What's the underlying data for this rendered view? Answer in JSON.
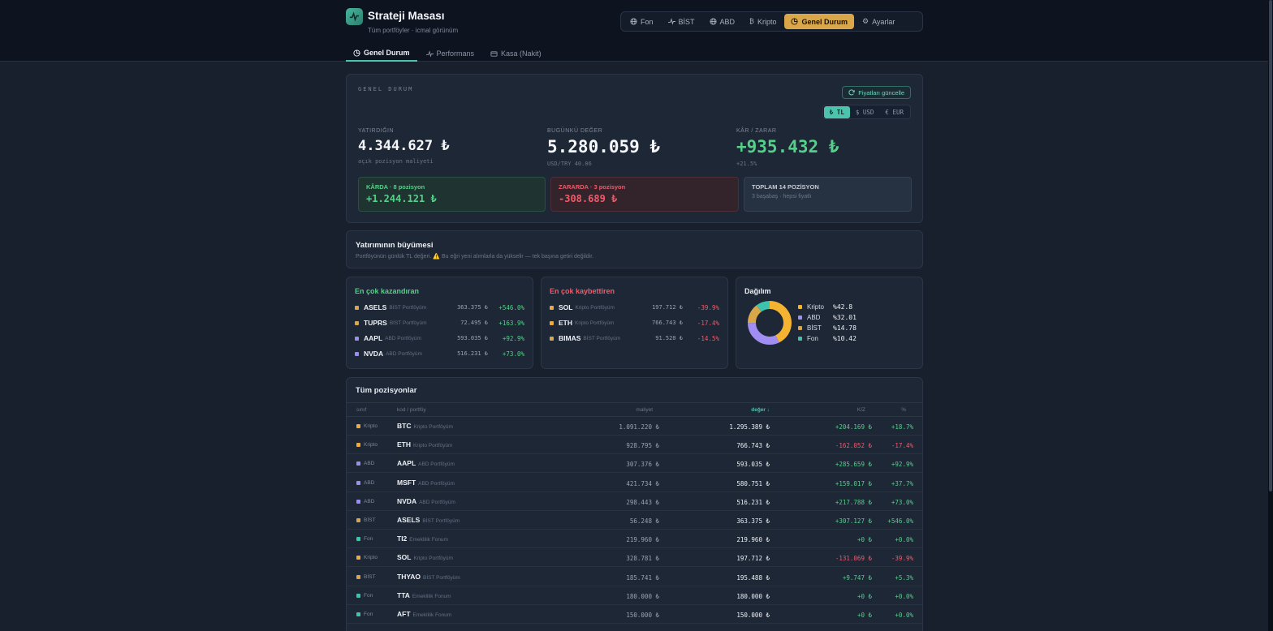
{
  "app": {
    "title": "Strateji Masası",
    "subtitle": "Tüm portföyler · icmal görünüm"
  },
  "nav": [
    {
      "label": "Fon",
      "icon": "globe-icon"
    },
    {
      "label": "BİST",
      "icon": "pulse-icon"
    },
    {
      "label": "ABD",
      "icon": "globe-icon"
    },
    {
      "label": "Kripto",
      "icon": "bitcoin-icon"
    },
    {
      "label": "Genel Durum",
      "icon": "pie-icon",
      "active": true
    },
    {
      "label": "Ayarlar",
      "icon": "gear-icon"
    }
  ],
  "tabs": [
    {
      "label": "Genel Durum",
      "active": true
    },
    {
      "label": "Performans"
    },
    {
      "label": "Kasa (Nakit)"
    }
  ],
  "summary": {
    "kicker": "GENEL DURUM",
    "refresh_label": "Fiyatları güncelle",
    "currencies": [
      "₺ TL",
      "$ USD",
      "€ EUR"
    ],
    "invested": {
      "label": "YATIRDIĞIN",
      "value": "4.344.627 ₺",
      "sub": "açık pozisyon maliyeti"
    },
    "today": {
      "label": "BUGÜNKÜ DEĞER",
      "value": "5.280.059 ₺",
      "sub": "USD/TRY 40.06"
    },
    "pl": {
      "label": "KÂR / ZARAR",
      "value": "+935.432 ₺",
      "sub": "+21.5%"
    },
    "gain": {
      "label": "KÂRDA · 8 pozisyon",
      "value": "+1.244.121 ₺"
    },
    "loss": {
      "label": "ZARARDA · 3 pozisyon",
      "value": "-308.689 ₺"
    },
    "total": {
      "label": "TOPLAM 14 POZİSYON",
      "sub": "3 başabaş · hepsi fiyatlı"
    }
  },
  "growth": {
    "title": "Yatırımının büyümesi",
    "sub": "Portföyünün günlük TL değeri. ⚠️ Bu eğri yeni alımlarla da yükselir — tek başına getiri değildir."
  },
  "gainers": {
    "title": "En çok kazandıran",
    "rows": [
      {
        "code": "ASELS",
        "port": "BİST Portföyüm",
        "amt": "363.375 ₺",
        "pct": "+546.0%",
        "color": "#d9a64a"
      },
      {
        "code": "TUPRS",
        "port": "BİST Portföyüm",
        "amt": "72.495 ₺",
        "pct": "+163.9%",
        "color": "#d9a64a"
      },
      {
        "code": "AAPL",
        "port": "ABD Portföyüm",
        "amt": "593.035 ₺",
        "pct": "+92.9%",
        "color": "#9b8cf0"
      },
      {
        "code": "NVDA",
        "port": "ABD Portföyüm",
        "amt": "516.231 ₺",
        "pct": "+73.0%",
        "color": "#9b8cf0"
      }
    ]
  },
  "losers": {
    "title": "En çok kaybettiren",
    "rows": [
      {
        "code": "SOL",
        "port": "Kripto Portföyüm",
        "amt": "197.712 ₺",
        "pct": "-39.9%",
        "color": "#f0a93a"
      },
      {
        "code": "ETH",
        "port": "Kripto Portföyüm",
        "amt": "766.743 ₺",
        "pct": "-17.4%",
        "color": "#f0a93a"
      },
      {
        "code": "BIMAS",
        "port": "BİST Portföyüm",
        "amt": "91.520 ₺",
        "pct": "-14.5%",
        "color": "#d9a64a"
      }
    ]
  },
  "distribution": {
    "title": "Dağılım",
    "items": [
      {
        "name": "Kripto",
        "label": "%42.8",
        "value": 42.8,
        "color": "#f4b431"
      },
      {
        "name": "ABD",
        "label": "%32.01",
        "value": 32.01,
        "color": "#a08ef2"
      },
      {
        "name": "BİST",
        "label": "%14.78",
        "value": 14.78,
        "color": "#d9a64a"
      },
      {
        "name": "Fon",
        "label": "%10.42",
        "value": 10.42,
        "color": "#3cc4ad"
      }
    ]
  },
  "positions": {
    "title": "Tüm pozisyonlar",
    "headers": {
      "class": "sınıf",
      "code": "kod / portföy",
      "cost": "maliyet",
      "value": "değer ↓",
      "pl": "K/Z",
      "pct": "%"
    },
    "rows": [
      {
        "cls": "Kripto",
        "code": "BTC",
        "port": "Kripto Portföyüm",
        "cost": "1.091.220 ₺",
        "value": "1.295.389 ₺",
        "pl": "+204.169 ₺",
        "pct": "+18.7%",
        "color": "#f0a93a",
        "pos": true
      },
      {
        "cls": "Kripto",
        "code": "ETH",
        "port": "Kripto Portföyüm",
        "cost": "928.795 ₺",
        "value": "766.743 ₺",
        "pl": "-162.052 ₺",
        "pct": "-17.4%",
        "color": "#f0a93a",
        "pos": false
      },
      {
        "cls": "ABD",
        "code": "AAPL",
        "port": "ABD Portföyüm",
        "cost": "307.376 ₺",
        "value": "593.035 ₺",
        "pl": "+285.659 ₺",
        "pct": "+92.9%",
        "color": "#9b8cf0",
        "pos": true
      },
      {
        "cls": "ABD",
        "code": "MSFT",
        "port": "ABD Portföyüm",
        "cost": "421.734 ₺",
        "value": "580.751 ₺",
        "pl": "+159.017 ₺",
        "pct": "+37.7%",
        "color": "#9b8cf0",
        "pos": true
      },
      {
        "cls": "ABD",
        "code": "NVDA",
        "port": "ABD Portföyüm",
        "cost": "298.443 ₺",
        "value": "516.231 ₺",
        "pl": "+217.788 ₺",
        "pct": "+73.0%",
        "color": "#9b8cf0",
        "pos": true
      },
      {
        "cls": "BİST",
        "code": "ASELS",
        "port": "BİST Portföyüm",
        "cost": "56.248 ₺",
        "value": "363.375 ₺",
        "pl": "+307.127 ₺",
        "pct": "+546.0%",
        "color": "#d9a64a",
        "pos": true
      },
      {
        "cls": "Fon",
        "code": "TI2",
        "port": "Emeklilik Fonum",
        "cost": "219.960 ₺",
        "value": "219.960 ₺",
        "pl": "+0 ₺",
        "pct": "+0.0%",
        "color": "#3cc4ad",
        "pos": true
      },
      {
        "cls": "Kripto",
        "code": "SOL",
        "port": "Kripto Portföyüm",
        "cost": "328.781 ₺",
        "value": "197.712 ₺",
        "pl": "-131.069 ₺",
        "pct": "-39.9%",
        "color": "#f0a93a",
        "pos": false
      },
      {
        "cls": "BİST",
        "code": "THYAO",
        "port": "BİST Portföyüm",
        "cost": "185.741 ₺",
        "value": "195.488 ₺",
        "pl": "+9.747 ₺",
        "pct": "+5.3%",
        "color": "#d9a64a",
        "pos": true
      },
      {
        "cls": "Fon",
        "code": "TTA",
        "port": "Emeklilik Fonum",
        "cost": "180.000 ₺",
        "value": "180.000 ₺",
        "pl": "+0 ₺",
        "pct": "+0.0%",
        "color": "#3cc4ad",
        "pos": true
      },
      {
        "cls": "Fon",
        "code": "AFT",
        "port": "Emeklilik Fonum",
        "cost": "150.000 ₺",
        "value": "150.000 ₺",
        "pl": "+0 ₺",
        "pct": "+0.0%",
        "color": "#3cc4ad",
        "pos": true
      }
    ]
  },
  "colors": {
    "accent": "#4cc3ac",
    "gold": "#d9a64a",
    "positive": "#55d08a",
    "negative": "#ef5b6b"
  }
}
